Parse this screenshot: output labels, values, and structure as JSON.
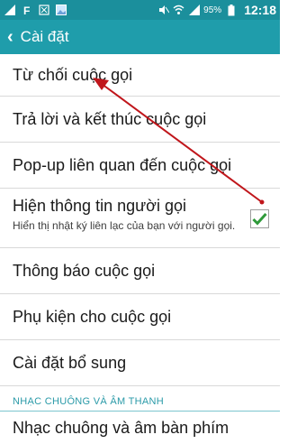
{
  "status_bar": {
    "battery_percent": "95%",
    "time": "12:18",
    "icons": [
      "signal-icon",
      "facebook-icon",
      "excel-icon",
      "image-icon",
      "mute-icon",
      "wifi-icon",
      "cellular-icon",
      "battery-icon"
    ]
  },
  "action_bar": {
    "title": "Cài đặt"
  },
  "items": [
    {
      "label": "Từ chối cuộc gọi"
    },
    {
      "label": "Trả lời và kết thúc cuộc gọi"
    },
    {
      "label": "Pop-up liên quan đến cuộc gọi"
    },
    {
      "label": "Hiện thông tin người gọi",
      "sub": "Hiển thị nhật ký liên lạc của bạn với người gọi.",
      "checked": true
    },
    {
      "label": "Thông báo cuộc gọi"
    },
    {
      "label": "Phụ kiện cho cuộc gọi"
    },
    {
      "label": "Cài đặt bổ sung"
    }
  ],
  "section": {
    "header": "NHẠC CHUÔNG VÀ ÂM THANH"
  },
  "last_item": {
    "label": "Nhạc chuông và âm bàn phím"
  },
  "colors": {
    "status_bar": "#1b8f9c",
    "action_bar": "#1f9dab",
    "annotation_arrow": "#c0161b",
    "check": "#2f9a3a"
  }
}
